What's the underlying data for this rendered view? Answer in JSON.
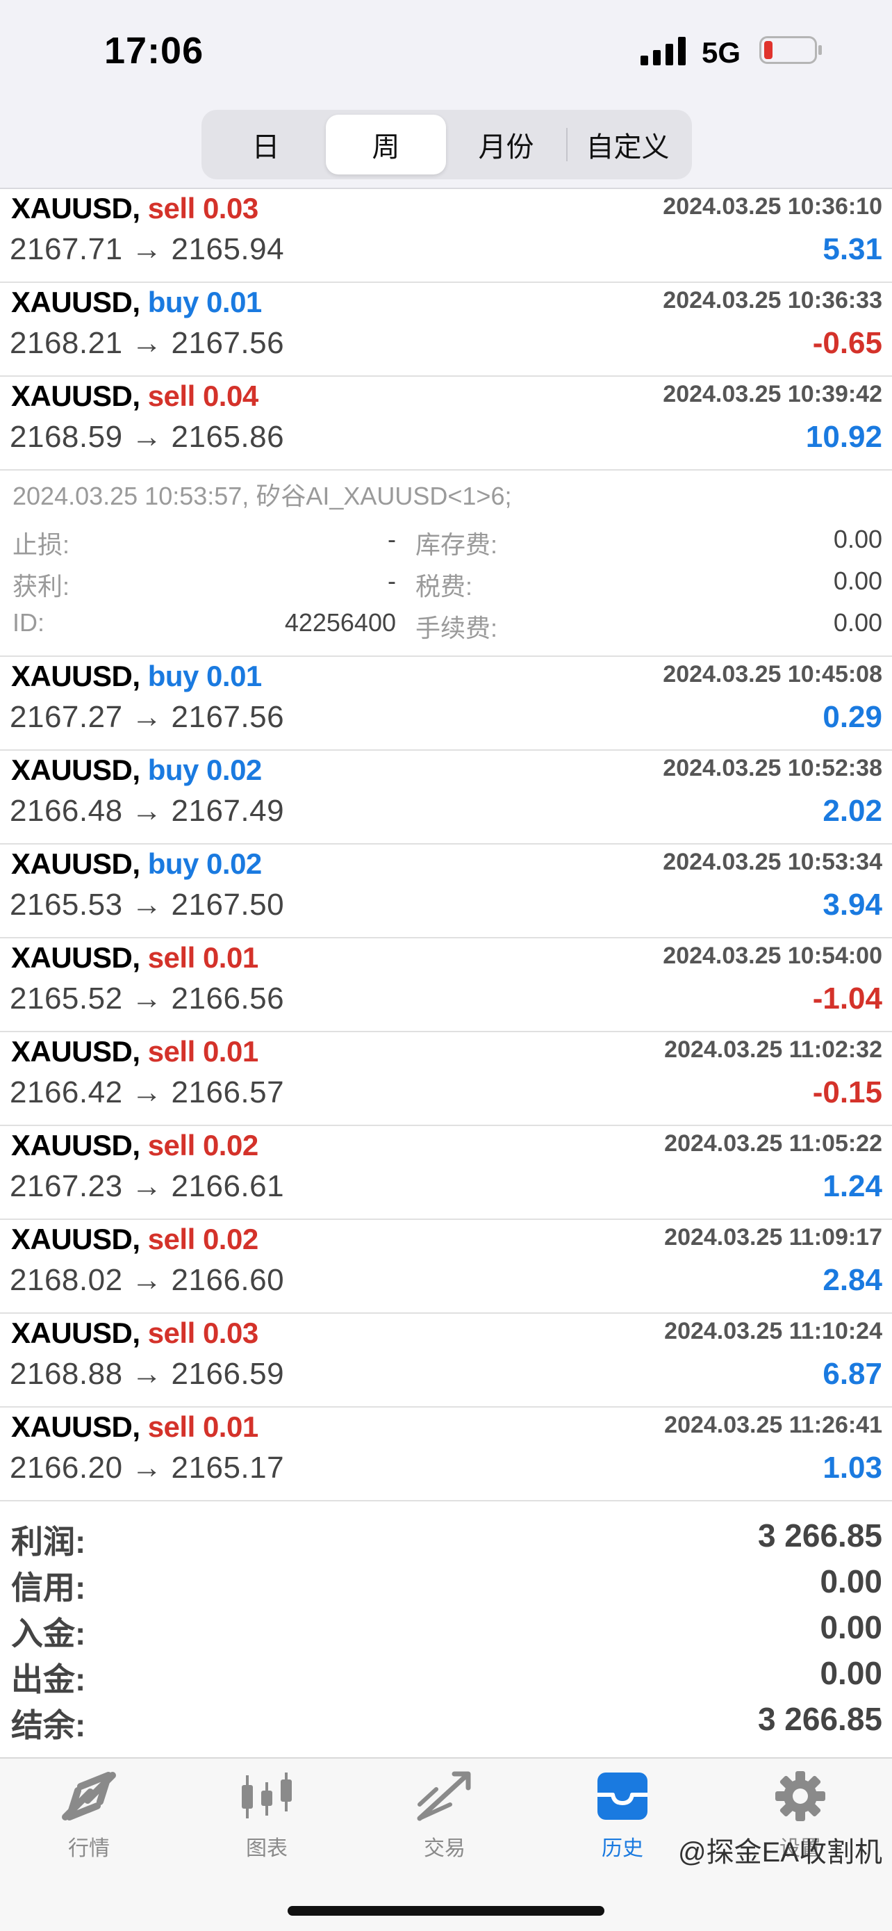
{
  "status": {
    "time": "17:06",
    "network": "5G"
  },
  "segment": {
    "tabs": [
      "日",
      "周",
      "月份",
      "自定义"
    ],
    "active": 1
  },
  "trades_before": [
    {
      "symbol": "XAUUSD,",
      "side": "sell",
      "lot": "0.03",
      "time": "2024.03.25 10:36:10",
      "open": "2167.71",
      "close": "2165.94",
      "arrow": "→",
      "profit": "5.31"
    },
    {
      "symbol": "XAUUSD,",
      "side": "buy",
      "lot": "0.01",
      "time": "2024.03.25 10:36:33",
      "open": "2168.21",
      "close": "2167.56",
      "arrow": "→",
      "profit": "-0.65"
    },
    {
      "symbol": "XAUUSD,",
      "side": "sell",
      "lot": "0.04",
      "time": "2024.03.25 10:39:42",
      "open": "2168.59",
      "close": "2165.86",
      "arrow": "→",
      "profit": "10.92"
    }
  ],
  "detail": {
    "comment": "2024.03.25 10:53:57, 矽谷AI_XAUUSD<1>6;",
    "sl_label": "止损:",
    "sl_value": "-",
    "tp_label": "获利:",
    "tp_value": "-",
    "id_label": "ID:",
    "id_value": "42256400",
    "swap_label": "库存费:",
    "swap_value": "0.00",
    "tax_label": "税费:",
    "tax_value": "0.00",
    "fee_label": "手续费:",
    "fee_value": "0.00"
  },
  "trades_after": [
    {
      "symbol": "XAUUSD,",
      "side": "buy",
      "lot": "0.01",
      "time": "2024.03.25 10:45:08",
      "open": "2167.27",
      "close": "2167.56",
      "arrow": "→",
      "profit": "0.29"
    },
    {
      "symbol": "XAUUSD,",
      "side": "buy",
      "lot": "0.02",
      "time": "2024.03.25 10:52:38",
      "open": "2166.48",
      "close": "2167.49",
      "arrow": "→",
      "profit": "2.02"
    },
    {
      "symbol": "XAUUSD,",
      "side": "buy",
      "lot": "0.02",
      "time": "2024.03.25 10:53:34",
      "open": "2165.53",
      "close": "2167.50",
      "arrow": "→",
      "profit": "3.94"
    },
    {
      "symbol": "XAUUSD,",
      "side": "sell",
      "lot": "0.01",
      "time": "2024.03.25 10:54:00",
      "open": "2165.52",
      "close": "2166.56",
      "arrow": "→",
      "profit": "-1.04"
    },
    {
      "symbol": "XAUUSD,",
      "side": "sell",
      "lot": "0.01",
      "time": "2024.03.25 11:02:32",
      "open": "2166.42",
      "close": "2166.57",
      "arrow": "→",
      "profit": "-0.15"
    },
    {
      "symbol": "XAUUSD,",
      "side": "sell",
      "lot": "0.02",
      "time": "2024.03.25 11:05:22",
      "open": "2167.23",
      "close": "2166.61",
      "arrow": "→",
      "profit": "1.24"
    },
    {
      "symbol": "XAUUSD,",
      "side": "sell",
      "lot": "0.02",
      "time": "2024.03.25 11:09:17",
      "open": "2168.02",
      "close": "2166.60",
      "arrow": "→",
      "profit": "2.84"
    },
    {
      "symbol": "XAUUSD,",
      "side": "sell",
      "lot": "0.03",
      "time": "2024.03.25 11:10:24",
      "open": "2168.88",
      "close": "2166.59",
      "arrow": "→",
      "profit": "6.87"
    },
    {
      "symbol": "XAUUSD,",
      "side": "sell",
      "lot": "0.01",
      "time": "2024.03.25 11:26:41",
      "open": "2166.20",
      "close": "2165.17",
      "arrow": "→",
      "profit": "1.03"
    }
  ],
  "summary": [
    {
      "label": "利润:",
      "value": "3 266.85"
    },
    {
      "label": "信用:",
      "value": "0.00"
    },
    {
      "label": "入金:",
      "value": "0.00"
    },
    {
      "label": "出金:",
      "value": "0.00"
    },
    {
      "label": "结余:",
      "value": "3 266.85"
    }
  ],
  "tabbar": [
    {
      "label": "行情",
      "icon": "quotes-icon"
    },
    {
      "label": "图表",
      "icon": "chart-icon"
    },
    {
      "label": "交易",
      "icon": "trade-icon"
    },
    {
      "label": "历史",
      "icon": "history-icon"
    },
    {
      "label": "设置",
      "icon": "settings-icon"
    }
  ],
  "tabbar_active": 3,
  "watermark": "@探金EA收割机",
  "colors": {
    "sell": "#d4322a",
    "buy": "#1a7ae0",
    "active": "#1a7ae0"
  }
}
